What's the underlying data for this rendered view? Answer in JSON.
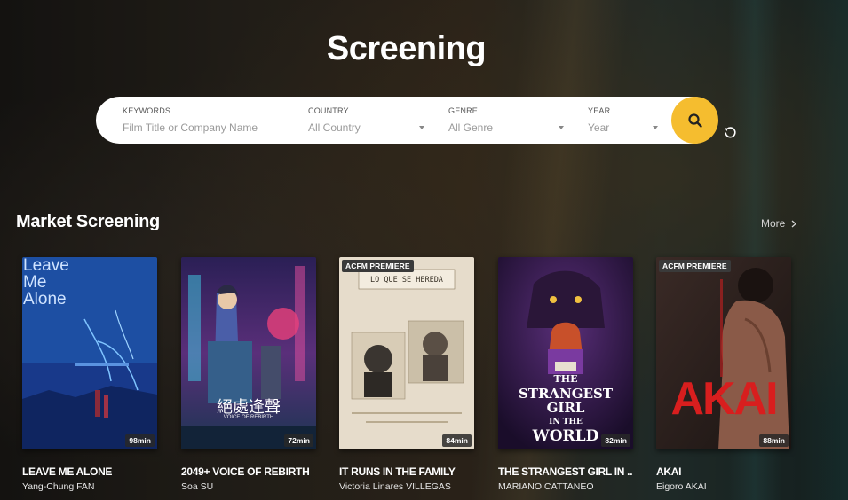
{
  "page": {
    "title": "Screening"
  },
  "search": {
    "keywords": {
      "label": "KEYWORDS",
      "placeholder": "Film Title or Company Name"
    },
    "country": {
      "label": "COUNTRY",
      "value": "All Country"
    },
    "genre": {
      "label": "GENRE",
      "value": "All Genre"
    },
    "year": {
      "label": "YEAR",
      "value": "Year"
    },
    "accent_color": "#f5bd2f",
    "search_icon": "search-icon",
    "reset_icon": "reset-icon"
  },
  "section": {
    "title": "Market Screening",
    "more_label": "More"
  },
  "films": [
    {
      "title": "LEAVE ME ALONE",
      "director": "Yang-Chung FAN",
      "runtime": "98min",
      "badge": "",
      "poster_text": [
        "Leave",
        "Me",
        "Alone"
      ]
    },
    {
      "title": "2049+ VOICE OF REBIRTH",
      "director": "Soa SU",
      "runtime": "72min",
      "badge": "",
      "poster_text": [
        "絕處逢聲",
        "VOICE OF REBIRTH"
      ]
    },
    {
      "title": "IT RUNS IN THE FAMILY",
      "director": "Victoria Linares VILLEGAS",
      "runtime": "84min",
      "badge": "ACFM PREMIERE",
      "poster_text": [
        "LO QUE SE HEREDA"
      ]
    },
    {
      "title": "THE STRANGEST GIRL IN ...",
      "director": "MARIANO CATTANEO",
      "runtime": "82min",
      "badge": "",
      "poster_text": [
        "THE",
        "STRANGEST GIRL",
        "IN THE",
        "WORLD"
      ]
    },
    {
      "title": "AKAI",
      "director": "Eigoro AKAI",
      "runtime": "88min",
      "badge": "ACFM PREMIERE",
      "poster_text": [
        "AKAI"
      ]
    }
  ]
}
